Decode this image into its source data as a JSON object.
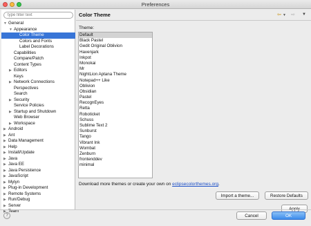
{
  "window": {
    "title": "Preferences"
  },
  "left": {
    "filter_placeholder": "type filter text",
    "tree": [
      {
        "label": "General",
        "depth": 0,
        "state": "open"
      },
      {
        "label": "Appearance",
        "depth": 1,
        "state": "open"
      },
      {
        "label": "Color Theme",
        "depth": 2,
        "state": "",
        "selected": true
      },
      {
        "label": "Colors and Fonts",
        "depth": 2,
        "state": ""
      },
      {
        "label": "Label Decorations",
        "depth": 2,
        "state": ""
      },
      {
        "label": "Capabilities",
        "depth": 1,
        "state": ""
      },
      {
        "label": "Compare/Patch",
        "depth": 1,
        "state": ""
      },
      {
        "label": "Content Types",
        "depth": 1,
        "state": ""
      },
      {
        "label": "Editors",
        "depth": 1,
        "state": "closed"
      },
      {
        "label": "Keys",
        "depth": 1,
        "state": ""
      },
      {
        "label": "Network Connections",
        "depth": 1,
        "state": "closed"
      },
      {
        "label": "Perspectives",
        "depth": 1,
        "state": ""
      },
      {
        "label": "Search",
        "depth": 1,
        "state": ""
      },
      {
        "label": "Security",
        "depth": 1,
        "state": "closed"
      },
      {
        "label": "Service Policies",
        "depth": 1,
        "state": ""
      },
      {
        "label": "Startup and Shutdown",
        "depth": 1,
        "state": "closed"
      },
      {
        "label": "Web Browser",
        "depth": 1,
        "state": ""
      },
      {
        "label": "Workspace",
        "depth": 1,
        "state": "closed"
      },
      {
        "label": "Android",
        "depth": 0,
        "state": "closed"
      },
      {
        "label": "Ant",
        "depth": 0,
        "state": "closed"
      },
      {
        "label": "Data Management",
        "depth": 0,
        "state": "closed"
      },
      {
        "label": "Help",
        "depth": 0,
        "state": "closed"
      },
      {
        "label": "Install/Update",
        "depth": 0,
        "state": "closed"
      },
      {
        "label": "Java",
        "depth": 0,
        "state": "closed"
      },
      {
        "label": "Java EE",
        "depth": 0,
        "state": "closed"
      },
      {
        "label": "Java Persistence",
        "depth": 0,
        "state": "closed"
      },
      {
        "label": "JavaScript",
        "depth": 0,
        "state": "closed"
      },
      {
        "label": "Mylyn",
        "depth": 0,
        "state": "closed"
      },
      {
        "label": "Plug-in Development",
        "depth": 0,
        "state": "closed"
      },
      {
        "label": "Remote Systems",
        "depth": 0,
        "state": "closed"
      },
      {
        "label": "Run/Debug",
        "depth": 0,
        "state": "closed"
      },
      {
        "label": "Server",
        "depth": 0,
        "state": "closed"
      },
      {
        "label": "Team",
        "depth": 0,
        "state": "closed"
      }
    ]
  },
  "main": {
    "title": "Color Theme",
    "theme_label": "Theme:",
    "themes": [
      "Default",
      "Black Pastel",
      "Gedit Original Oblivion",
      "Havenjark",
      "Inkpot",
      "Monokai",
      "Mr",
      "NightLion Aptana Theme",
      "Notepad++ Like",
      "Oblivion",
      "Obsidian",
      "Pastel",
      "RecognEyes",
      "Retta",
      "Roboticket",
      "Schuss",
      "Sublime Text 2",
      "Sunburst",
      "Tango",
      "Vibrant Ink",
      "Wombat",
      "Zenburn",
      "frontenddev",
      "minimal"
    ],
    "selected_theme": "Default",
    "download_prefix": "Download more themes or create your own on ",
    "download_link": "eclipsecolorthemes.org",
    "download_suffix": ".",
    "import_label": "Import a theme...",
    "restore_label": "Restore Defaults",
    "apply_label": "Apply"
  },
  "footer": {
    "cancel_label": "Cancel",
    "ok_label": "OK",
    "help_glyph": "?"
  },
  "icons": {
    "back": "back-arrow-icon",
    "forward": "forward-arrow-icon",
    "menu": "view-menu-icon",
    "expand": "triangle-expand-icon",
    "collapse": "triangle-collapse-icon"
  },
  "colors": {
    "selection": "#3875d7",
    "link": "#1a4ec7",
    "default_button": "#3d8cec"
  }
}
